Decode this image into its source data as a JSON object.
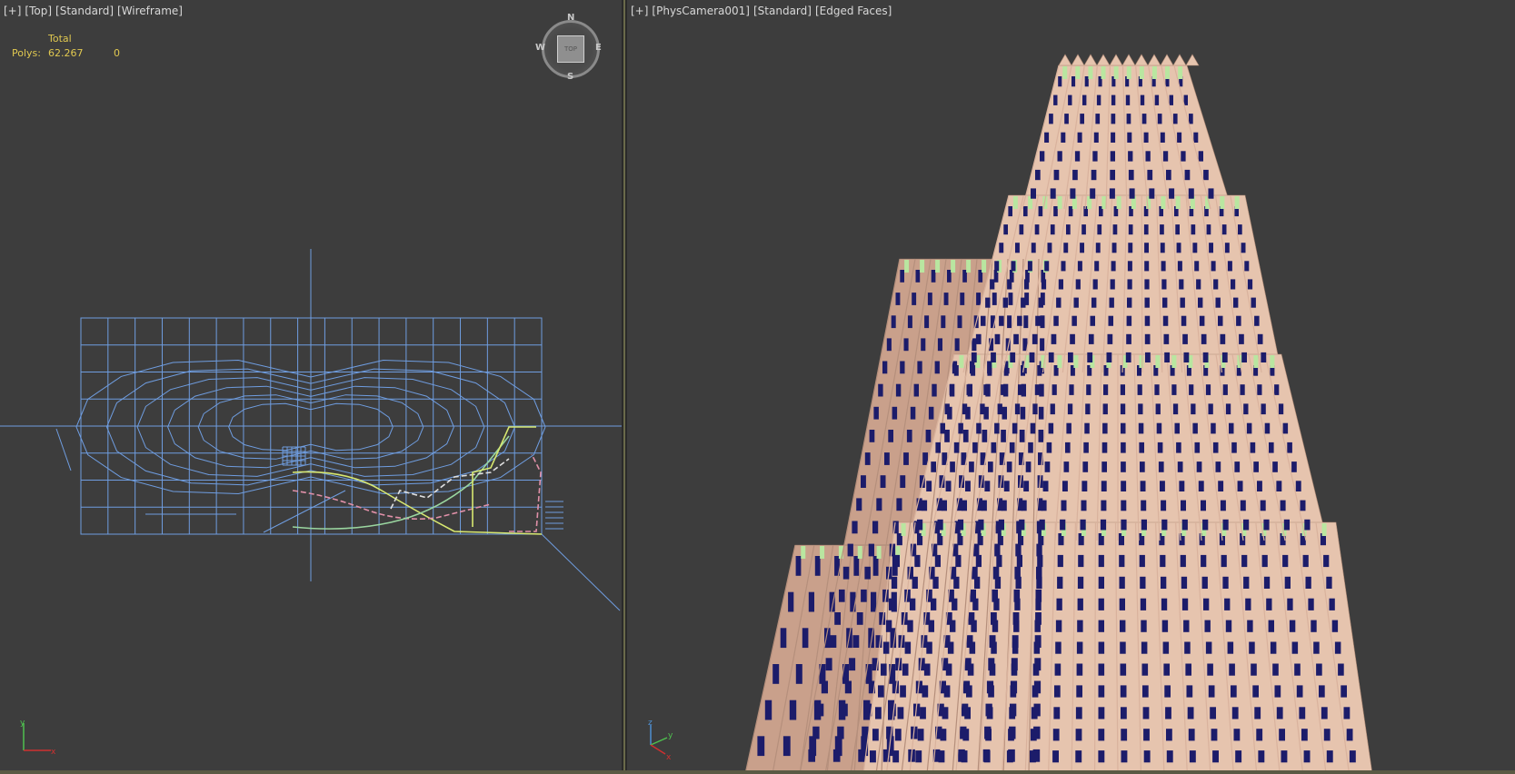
{
  "left_viewport": {
    "labels": [
      "[+]",
      "[Top]",
      "[Standard]",
      "[Wireframe]"
    ],
    "stats": {
      "header": "Total",
      "polys_label": "Polys:",
      "polys_total": "62.267",
      "polys_selected": "0"
    },
    "viewcube": {
      "face": "TOP",
      "n": "N",
      "s": "S",
      "e": "E",
      "w": "W"
    },
    "axis": {
      "x": "x",
      "y": "y"
    }
  },
  "right_viewport": {
    "labels": [
      "[+]",
      "[PhysCamera001]",
      "[Standard]",
      "[Edged Faces]"
    ],
    "axis": {
      "x": "x",
      "y": "y",
      "z": "z"
    }
  },
  "colors": {
    "viewport_bg": "#3d3d3d",
    "wire_blue": "#6f9de0",
    "stats_yellow": "#e0c850",
    "building_facade": "#e6c4ae",
    "window_navy": "#1c1c6a",
    "roof_green": "#b9e6a0"
  }
}
